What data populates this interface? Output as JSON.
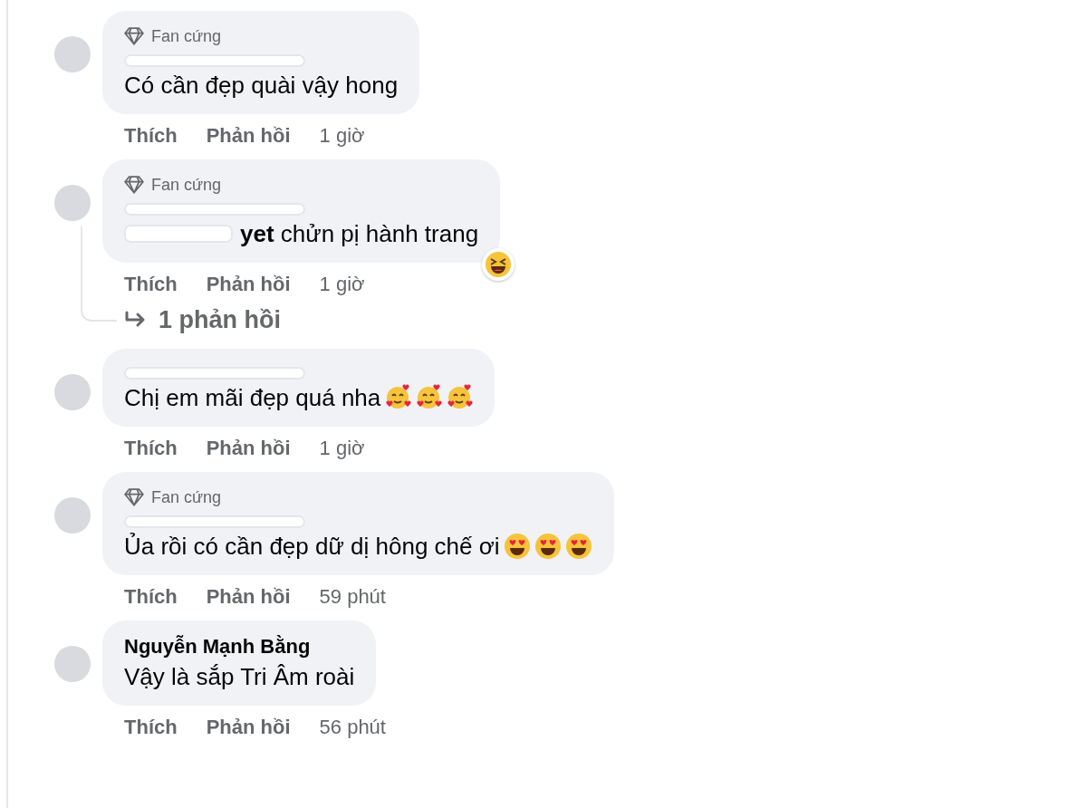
{
  "comments": [
    {
      "badge": "Fan cứng",
      "name_hidden": true,
      "text": "Có cần đẹp quài vậy hong",
      "actions": {
        "like": "Thích",
        "reply": "Phản hồi",
        "time": "1 giờ"
      }
    },
    {
      "badge": "Fan cứng",
      "name_hidden": true,
      "mention_hidden": true,
      "text": "**yet** chửn pị hành trang",
      "reaction": {
        "kind": "haha"
      },
      "actions": {
        "like": "Thích",
        "reply": "Phản hồi",
        "time": "1 giờ"
      },
      "replies": "1 phản hồi"
    },
    {
      "name_hidden": true,
      "text": "Chị em mãi đẹp quá nha",
      "emojis": [
        {
          "kind": "hearts"
        },
        {
          "kind": "hearts"
        },
        {
          "kind": "hearts"
        }
      ],
      "actions": {
        "like": "Thích",
        "reply": "Phản hồi",
        "time": "1 giờ"
      }
    },
    {
      "badge": "Fan cứng",
      "name_hidden": true,
      "text": "Ủa rồi có cần đẹp dữ dị hông chế ơi ",
      "emojis": [
        {
          "kind": "heart-eyes"
        },
        {
          "kind": "heart-eyes"
        },
        {
          "kind": "heart-eyes"
        }
      ],
      "actions": {
        "like": "Thích",
        "reply": "Phản hồi",
        "time": "59 phút"
      }
    },
    {
      "name_hidden": false,
      "name": "Nguyễn Mạnh Bằng",
      "text": "Vậy là sắp Tri Âm roài",
      "actions": {
        "like": "Thích",
        "reply": "Phản hồi",
        "time": "56 phút"
      }
    }
  ]
}
